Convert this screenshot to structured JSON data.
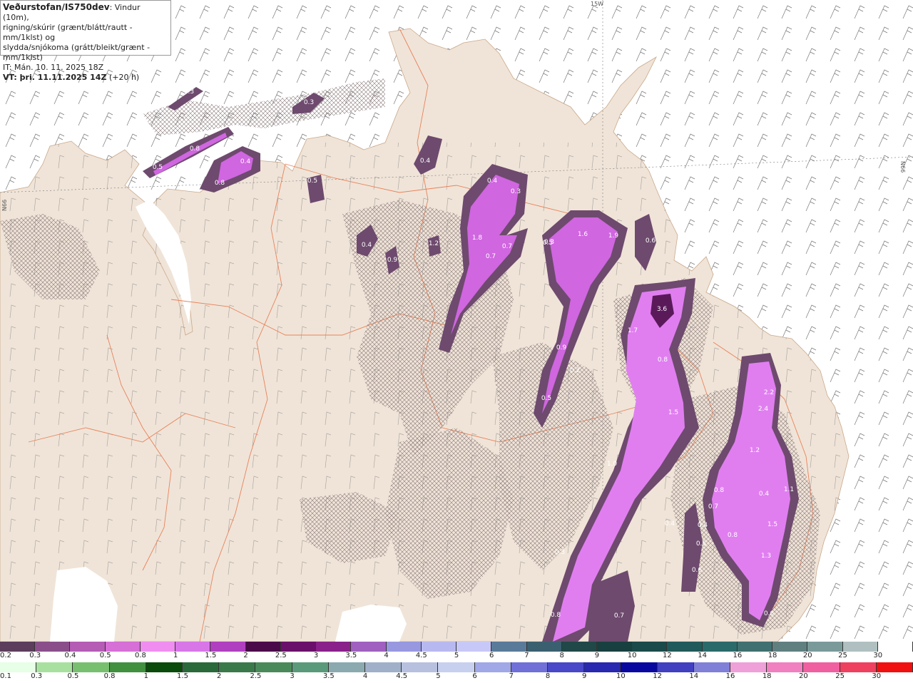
{
  "legend": {
    "title": "Veðurstofan/IS750dev",
    "title_suffix": ": Vindur (10m),",
    "line2": "rigning/skúrir (grænt/blátt/rautt - mm/1klst) og",
    "line3": "slydda/snjókoma (grátt/bleikt/grænt - mm/1klst)",
    "it": "IT: Mán. 10. 11. 2025 18Z",
    "vt": "VT: þri. 11.11.2025 14Z",
    "vt_offset": "(+20 h)"
  },
  "grid_labels": {
    "meridian": "15W",
    "lat_left": "N66",
    "lat_right": "N66"
  },
  "snow_scale": {
    "labels": [
      "0.2",
      "0.3",
      "0.4",
      "0.5",
      "0.8",
      "1",
      "1.5",
      "2",
      "2.5",
      "3",
      "3.5",
      "4",
      "4.5",
      "5",
      "6",
      "7",
      "8",
      "9",
      "10",
      "12",
      "14",
      "16",
      "18",
      "20",
      "25",
      "30"
    ],
    "colors": [
      "#5c3d5c",
      "#8a4f8a",
      "#b55cb5",
      "#d66fd6",
      "#f08df0",
      "#d876e8",
      "#b040c0",
      "#4a0a4a",
      "#6a106a",
      "#8a208a",
      "#a060c0",
      "#9898e0",
      "#b8b8f0",
      "#c8c8f8",
      "#5a7a9a",
      "#3a6070",
      "#204848",
      "#184040",
      "#1a4a4a",
      "#205a5a",
      "#2a6a6a",
      "#407070",
      "#608080",
      "#7a9a9a",
      "#b0c0c0",
      "#ffffff"
    ]
  },
  "rain_scale": {
    "labels": [
      "0.1",
      "0.3",
      "0.5",
      "0.8",
      "1",
      "1.5",
      "2",
      "2.5",
      "3",
      "3.5",
      "4",
      "4.5",
      "5",
      "6",
      "7",
      "8",
      "9",
      "10",
      "12",
      "14",
      "16",
      "18",
      "20",
      "25",
      "30"
    ],
    "colors": [
      "#e6ffe6",
      "#a8e0a0",
      "#78c070",
      "#409040",
      "#0a4a0a",
      "#2a6a3a",
      "#3a7a4a",
      "#4a8a5a",
      "#5a9a7a",
      "#8aaab0",
      "#a0b0c8",
      "#b8c0e0",
      "#c8d0f0",
      "#a0a8e8",
      "#7070d8",
      "#4848c8",
      "#2828b0",
      "#0808a0",
      "#4040c0",
      "#8080d8",
      "#f0a0d8",
      "#f080c0",
      "#f060a0",
      "#f04060",
      "#f01010"
    ]
  },
  "precip_labels": [
    "0.3",
    "0.3",
    "0.8",
    "0.5",
    "0.4",
    "0.8",
    "0.5",
    "0.4",
    "0.4",
    "0.9",
    "1.2",
    "0.4",
    "0.3",
    "0.3",
    "1.8",
    "0.7",
    "0.7",
    "0.5",
    "1.6",
    "1.9",
    "0.6",
    "3.6",
    "1.7",
    "0.8",
    "0.9",
    "0.2",
    "0.5",
    "1.5",
    "2.2",
    "2.4",
    "1.2",
    "1.0",
    "0.8",
    "0.7",
    "0.4",
    "1.1",
    "0.4",
    "0.4",
    "1.5",
    "0.8",
    "0.5",
    "1.3",
    "0.6",
    "0.3",
    "0.8",
    "0.7",
    "0.6"
  ],
  "colors": {
    "land": "#f0e4d8",
    "sea": "#ffffff",
    "roads": "#e8825a",
    "hatch": "#8a7a7a",
    "snow_light": "#6e4a6e",
    "snow_mid": "#c050c0",
    "snow_bright": "#f07cf0",
    "snow_dark": "#5a1a5a"
  }
}
